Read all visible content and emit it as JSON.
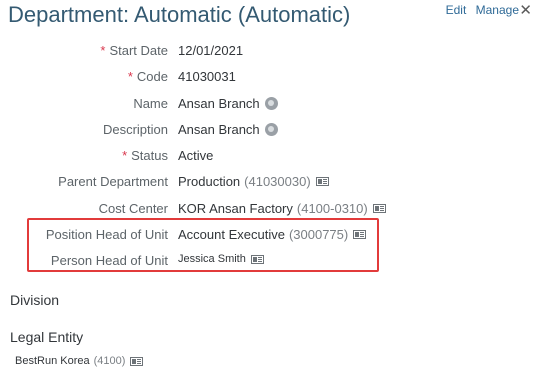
{
  "header": {
    "title": "Department: Automatic (Automatic)",
    "edit_label": "Edit",
    "manage_label": "Manage",
    "close_icon": "close-icon"
  },
  "fields": {
    "start_date": {
      "label": "Start Date",
      "required": true,
      "value": "12/01/2021"
    },
    "code": {
      "label": "Code",
      "required": true,
      "value": "41030031"
    },
    "name": {
      "label": "Name",
      "value": "Ansan Branch",
      "icon": "globe-icon"
    },
    "description": {
      "label": "Description",
      "value": "Ansan Branch",
      "icon": "globe-icon"
    },
    "status": {
      "label": "Status",
      "required": true,
      "value": "Active"
    },
    "parent_department": {
      "label": "Parent Department",
      "value": "Production",
      "sub": "(41030030)",
      "icon": "card-icon"
    },
    "cost_center": {
      "label": "Cost Center",
      "value": "KOR Ansan Factory",
      "sub": "(4100-0310)",
      "icon": "card-icon"
    },
    "position_head": {
      "label": "Position Head of Unit",
      "value": "Account Executive",
      "sub": "(3000775)",
      "icon": "card-icon"
    },
    "person_head": {
      "label": "Person Head of Unit",
      "value": "Jessica Smith",
      "icon": "card-icon"
    }
  },
  "required_marker": "*",
  "sections": {
    "division": "Division",
    "legal_entity": "Legal Entity"
  },
  "legal_entity_value": {
    "name": "BestRun Korea",
    "sub": "(4100)",
    "icon": "card-icon"
  },
  "colors": {
    "title": "#345a72",
    "link": "#2f6a97",
    "required": "#d9364c",
    "highlight_border": "#e23b3b"
  }
}
